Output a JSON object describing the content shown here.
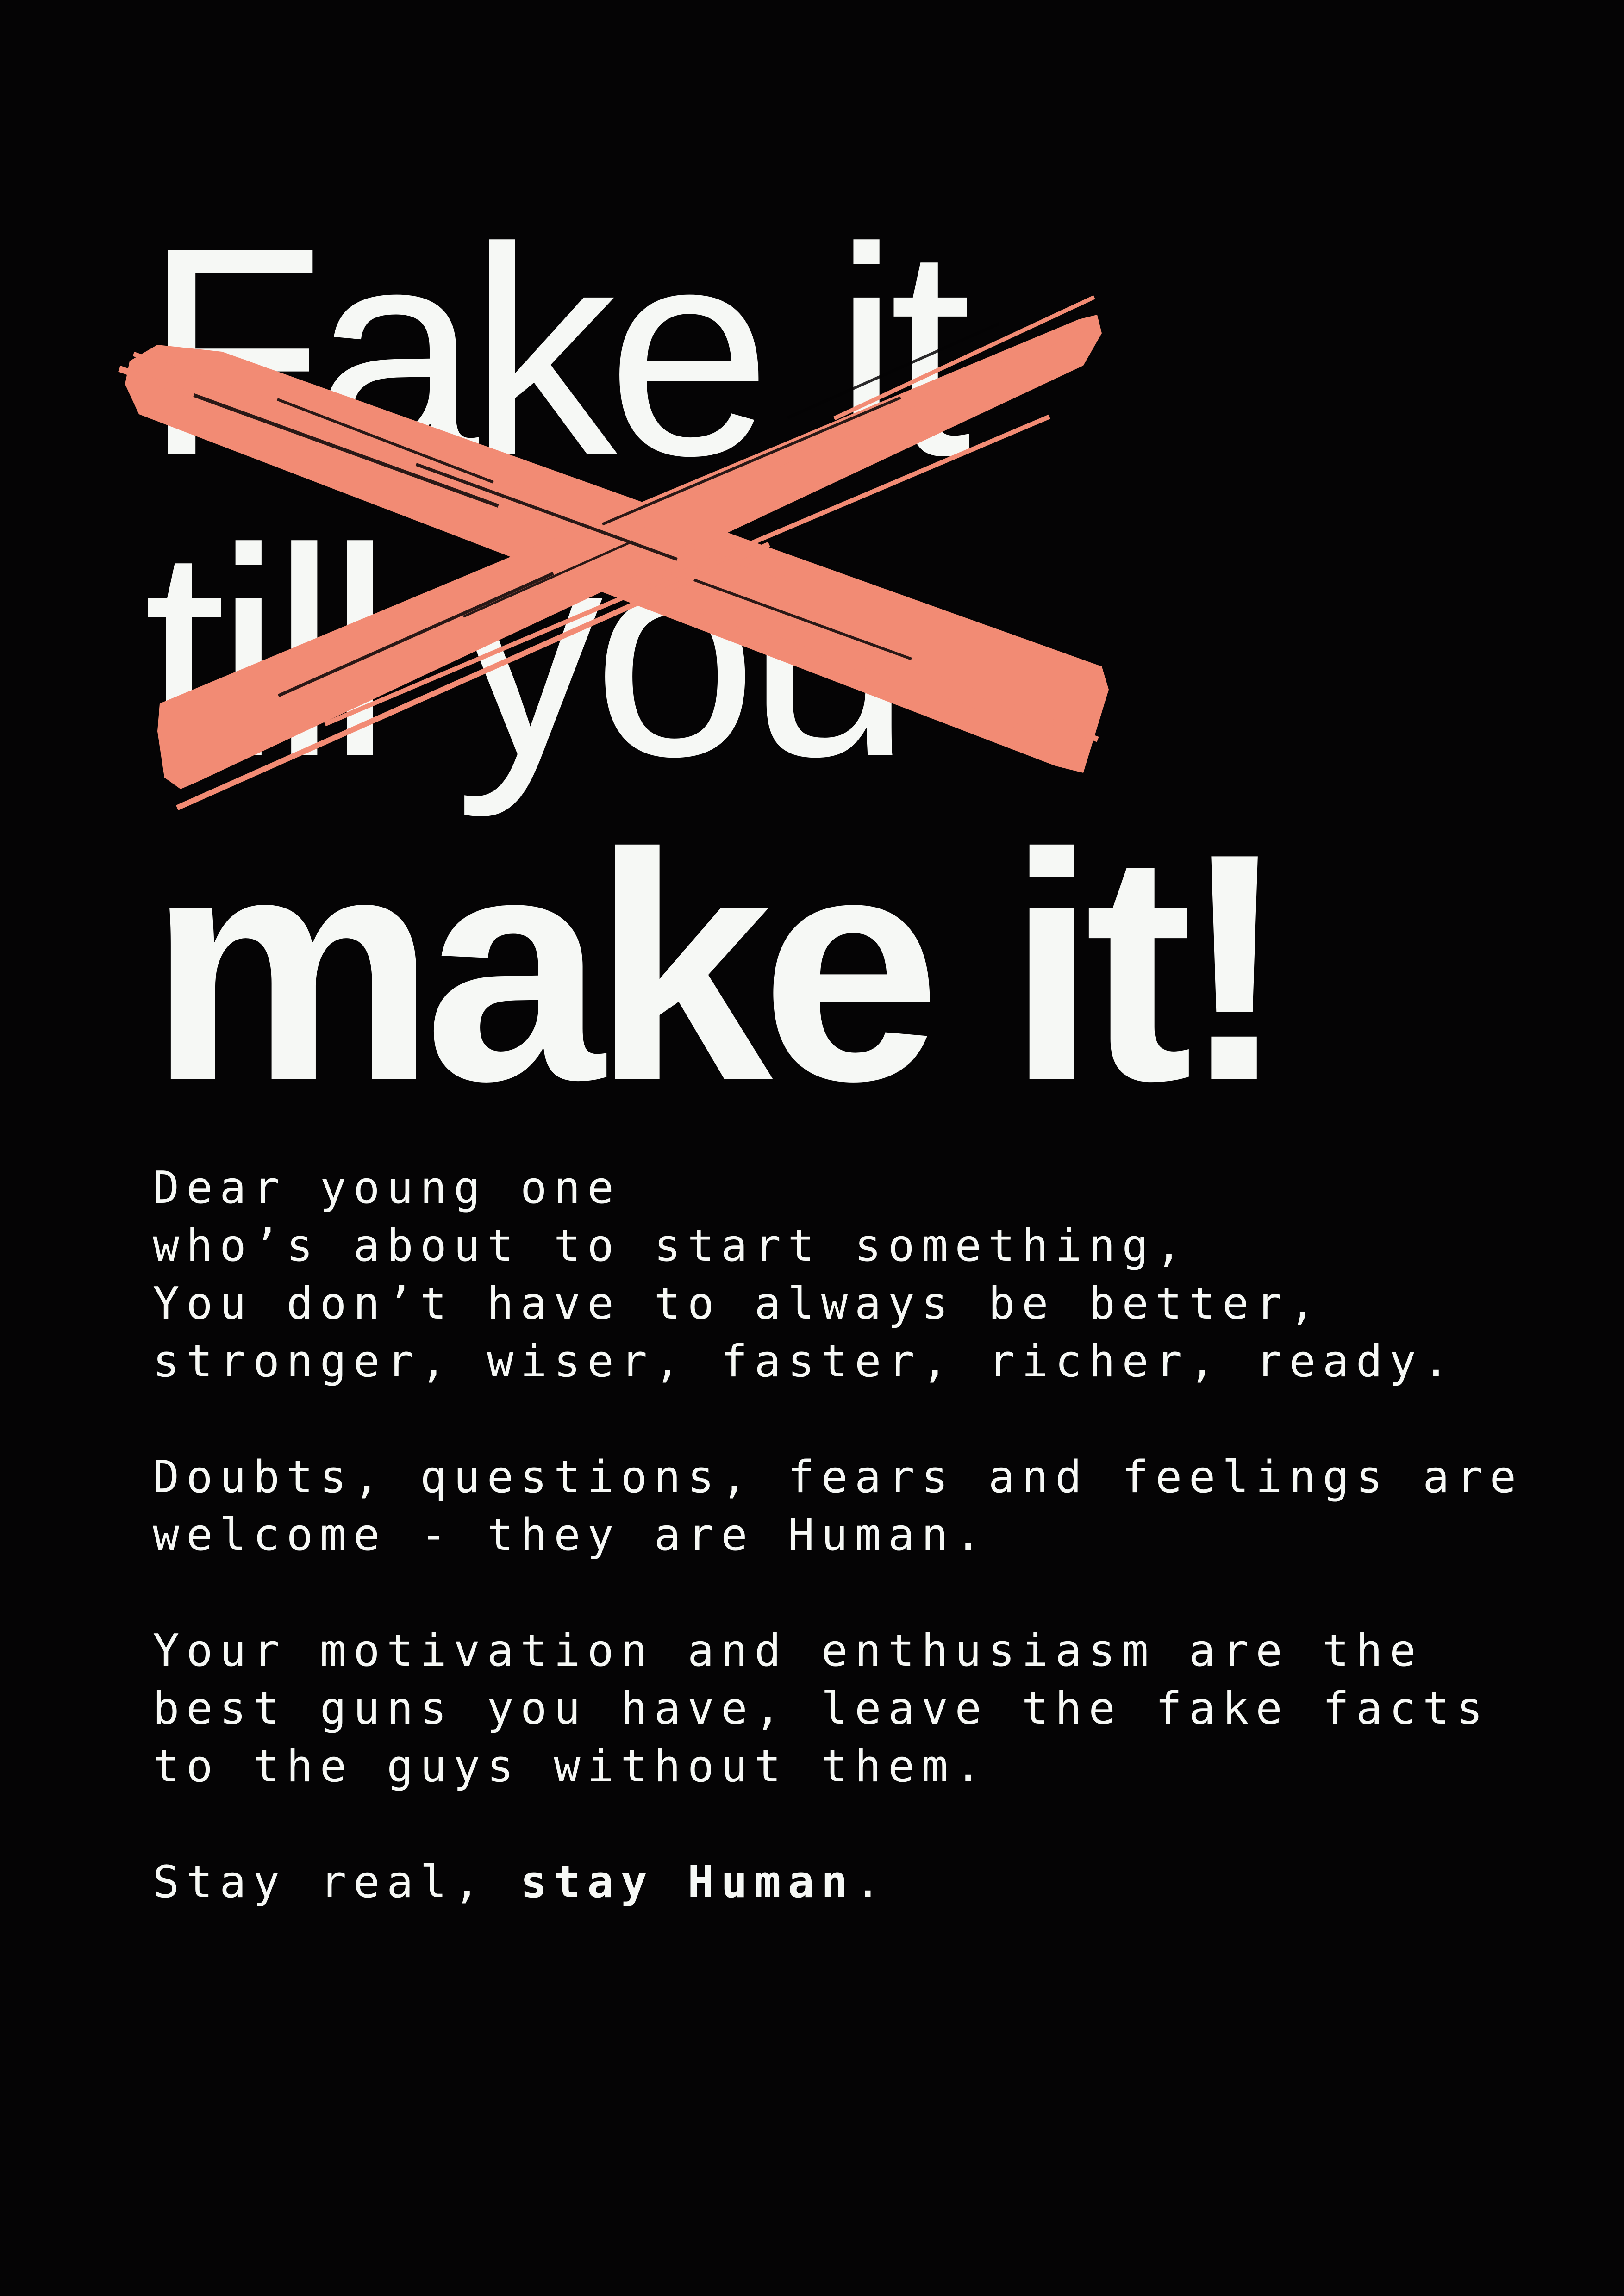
{
  "headline": {
    "line1": "Fake it",
    "line2": "till you",
    "line3": "make it!"
  },
  "cross_mark": {
    "name": "brush-stroke-x",
    "color": "#f28b74"
  },
  "letter": {
    "paragraph1": [
      "Dear young one",
      "who’s about to start something,",
      "You don’t have to always be better,",
      "stronger, wiser, faster, richer, ready."
    ],
    "paragraph2": [
      "Doubts, questions, fears and feelings are",
      "welcome - they are Human."
    ],
    "paragraph3": [
      "Your motivation and enthusiasm are the",
      "best guns you have, leave the fake facts",
      "to the guys without them."
    ],
    "closing": {
      "prefix": "Stay real, ",
      "emphasis": "stay Human",
      "suffix": "."
    }
  },
  "colors": {
    "background": "#050405",
    "text": "#f6f8f5",
    "accent": "#f28b74"
  }
}
